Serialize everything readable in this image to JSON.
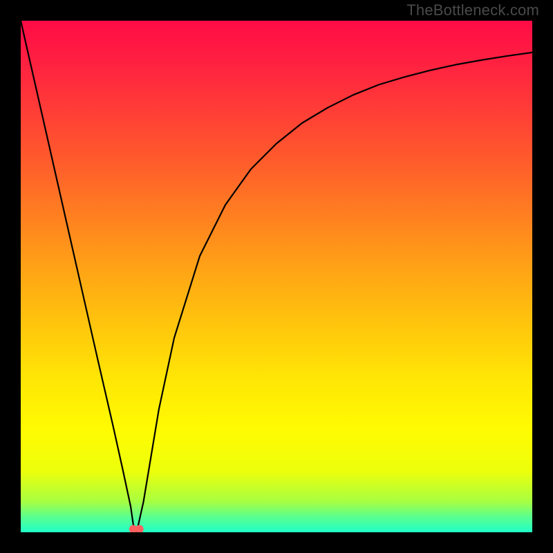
{
  "watermark": "TheBottleneck.com",
  "chart_data": {
    "type": "line",
    "title": "",
    "xlabel": "",
    "ylabel": "",
    "xlim": [
      0,
      100
    ],
    "ylim": [
      0,
      100
    ],
    "grid": false,
    "legend": false,
    "background_gradient": {
      "stops": [
        {
          "offset": 0.0,
          "color": "#ff0b46"
        },
        {
          "offset": 0.09,
          "color": "#ff2340"
        },
        {
          "offset": 0.28,
          "color": "#ff5d2b"
        },
        {
          "offset": 0.5,
          "color": "#ffa814"
        },
        {
          "offset": 0.7,
          "color": "#ffe605"
        },
        {
          "offset": 0.8,
          "color": "#fffb02"
        },
        {
          "offset": 0.88,
          "color": "#edff0b"
        },
        {
          "offset": 0.94,
          "color": "#a7ff41"
        },
        {
          "offset": 0.97,
          "color": "#5aff90"
        },
        {
          "offset": 1.0,
          "color": "#20ffc8"
        }
      ]
    },
    "series": [
      {
        "name": "bottleneck-curve",
        "color": "#000000",
        "x": [
          0,
          5,
          10,
          15,
          18,
          20,
          21.5,
          22,
          22.5,
          23,
          24,
          25,
          27,
          30,
          35,
          40,
          45,
          50,
          55,
          60,
          65,
          70,
          75,
          80,
          85,
          90,
          95,
          100
        ],
        "values": [
          100,
          78,
          56,
          34,
          21,
          12,
          5,
          1.5,
          0,
          1.5,
          6,
          12,
          24,
          38,
          54,
          64,
          71,
          76,
          80,
          83,
          85.5,
          87.5,
          89,
          90.3,
          91.4,
          92.3,
          93.1,
          93.8
        ]
      }
    ],
    "markers": [
      {
        "name": "minimum-marker-left",
        "x": 22.0,
        "y": 0.6,
        "color": "#ff6060",
        "r": 6
      },
      {
        "name": "minimum-marker-right",
        "x": 23.2,
        "y": 0.6,
        "color": "#ff6060",
        "r": 6
      }
    ]
  }
}
